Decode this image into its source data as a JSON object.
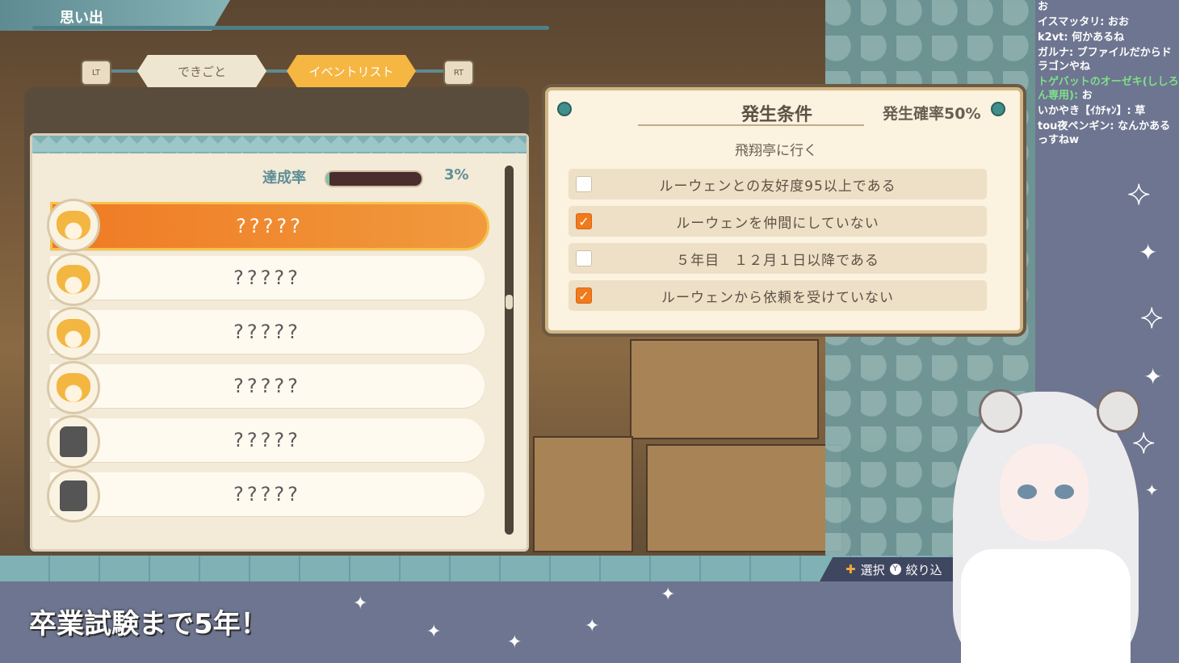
{
  "screen": {
    "title": "思い出",
    "tabs": [
      {
        "label": "できごと",
        "active": false
      },
      {
        "label": "イベントリスト",
        "active": true
      }
    ],
    "shoulder_left": "LT",
    "shoulder_right": "RT"
  },
  "event_list": {
    "rate_label": "達成率",
    "rate_value": "3%",
    "rate_fraction": 0.03,
    "items": [
      {
        "name": "?????",
        "icon": "hair-portrait-icon",
        "selected": true
      },
      {
        "name": "?????",
        "icon": "hair-portrait-icon",
        "selected": false
      },
      {
        "name": "?????",
        "icon": "hair-portrait-icon",
        "selected": false
      },
      {
        "name": "?????",
        "icon": "hair-portrait-icon",
        "selected": false
      },
      {
        "name": "?????",
        "icon": "unknown-portrait-icon",
        "selected": false
      },
      {
        "name": "?????",
        "icon": "unknown-portrait-icon",
        "selected": false
      }
    ]
  },
  "conditions": {
    "title": "発生条件",
    "probability": "発生確率50%",
    "place": "飛翔亭に行く",
    "items": [
      {
        "text": "ルーウェンとの友好度95以上である",
        "checked": false
      },
      {
        "text": "ルーウェンを仲間にしていない",
        "checked": true
      },
      {
        "text": "５年目　１２月１日以降である",
        "checked": false
      },
      {
        "text": "ルーウェンから依頼を受けていない",
        "checked": true
      }
    ]
  },
  "hints": {
    "select": "選択",
    "filter": "絞り込"
  },
  "chat": [
    {
      "name": "",
      "text": "お"
    },
    {
      "name": "イスマッタリ:",
      "text": "おお"
    },
    {
      "name": "k2vt:",
      "text": "何かあるね"
    },
    {
      "name": "ガルナ:",
      "text": "ブファイルだからドラゴンやね"
    },
    {
      "name": "トゲバットのオーゼキ(ししろん専用):",
      "text": "お"
    },
    {
      "name": "いかやき【ｲｶﾁｬﾝ】:",
      "text": "草"
    },
    {
      "name": "tou夜ペンギン:",
      "text": "なんかあるっすねw"
    }
  ],
  "caption": "卒業試験まで5年！",
  "colors": {
    "accent_orange": "#f17a1b",
    "teal": "#5e8a91",
    "panel_cream": "#fbf2df"
  }
}
